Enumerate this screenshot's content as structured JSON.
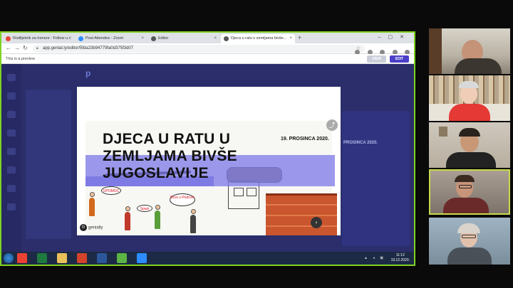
{
  "browser": {
    "tabs": [
      {
        "label": "Rodiljetnik za trenere - Follow u...",
        "color": "#ea4335"
      },
      {
        "label": "Post Attendee - Zoom",
        "color": "#2d8cff"
      },
      {
        "label": "Editor",
        "color": "#555555"
      },
      {
        "label": "Djeca u ratu u zemljama bivše...",
        "color": "#555555"
      }
    ],
    "new_tab": "+",
    "url": "app.genial.ly/editor/5fda23b94779fa0d375f3d07"
  },
  "preview_bar": {
    "notice": "This is a preview",
    "view_label": "VIEW",
    "edit_label": "EDIT"
  },
  "slide": {
    "title": "DJECA U RATU U ZEMLJAMA BIVŠE JUGOSLAVIJE",
    "date": "19. PROSINCA 2020.",
    "brand": "genially",
    "bubble_1": "Bruo u Podrum",
    "bubble_2": "UPOMOĆ",
    "bubble_3": "Spasi"
  },
  "right_panel": {
    "date_echo": "PROSINCA 2020."
  },
  "taskbar": {
    "time": "11:12",
    "date": "19.12.2020."
  },
  "participants": [
    {
      "name": "participant-1"
    },
    {
      "name": "participant-2"
    },
    {
      "name": "participant-3"
    },
    {
      "name": "participant-4"
    },
    {
      "name": "participant-5"
    }
  ]
}
